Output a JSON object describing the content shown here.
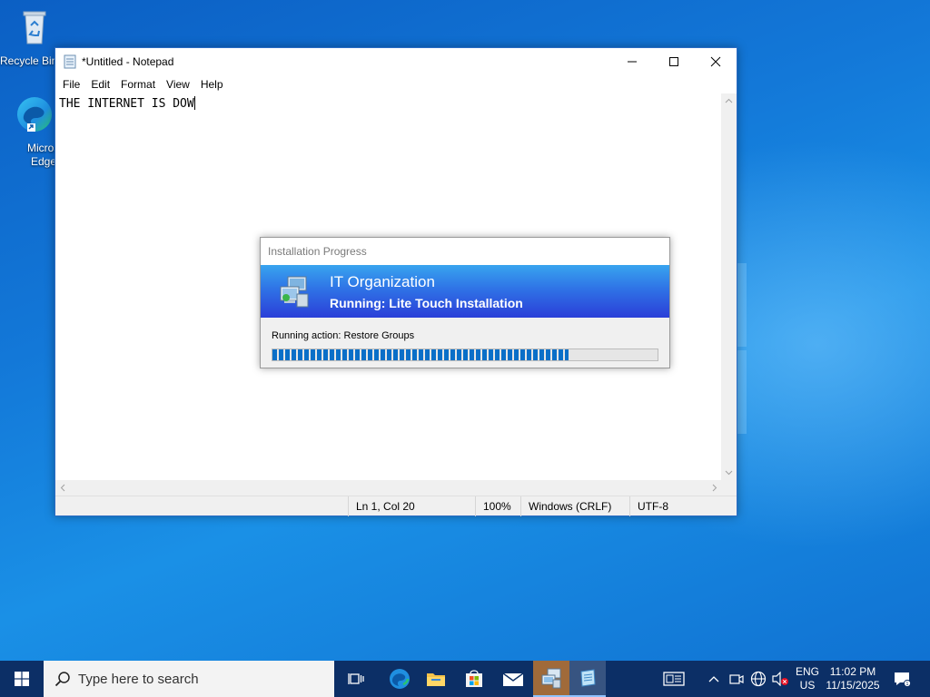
{
  "desktop": {
    "icons": [
      {
        "label": "Recycle Bin"
      },
      {
        "label": "Microsoft Edge"
      }
    ]
  },
  "notepad": {
    "title": "*Untitled - Notepad",
    "menu": [
      "File",
      "Edit",
      "Format",
      "View",
      "Help"
    ],
    "content": "THE INTERNET IS DOW",
    "status": {
      "position": "Ln 1, Col 20",
      "zoom": "100%",
      "line_ending": "Windows (CRLF)",
      "encoding": "UTF-8"
    }
  },
  "install_dialog": {
    "title": "Installation Progress",
    "organization": "IT Organization",
    "running": "Running: Lite Touch Installation",
    "action": "Running action: Restore Groups",
    "progress_percent": 77
  },
  "taskbar": {
    "search_placeholder": "Type here to search",
    "language_top": "ENG",
    "language_bottom": "US",
    "time": "11:02 PM",
    "date": "11/15/2025"
  },
  "colors": {
    "accent": "#0a6fc8",
    "banner_top": "#38a4ef",
    "banner_bottom": "#2b3fd8",
    "taskbar": "#0c2f66"
  }
}
